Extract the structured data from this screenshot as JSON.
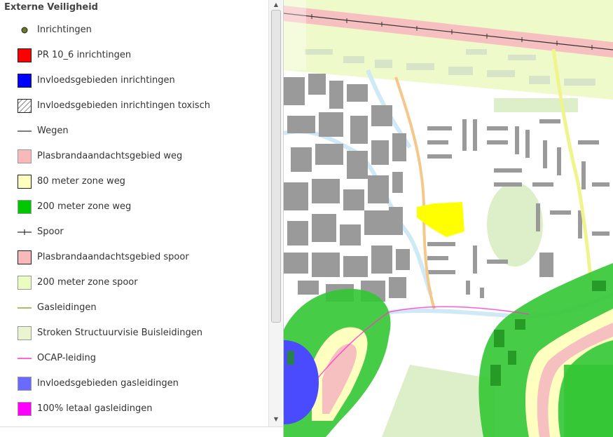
{
  "legend": {
    "title": "Externe Veiligheid",
    "items": [
      {
        "label": "Inrichtingen",
        "symbol": "dot",
        "color": "#6b7a1e"
      },
      {
        "label": "PR 10_6 inrichtingen",
        "symbol": "box",
        "color": "#ff0000"
      },
      {
        "label": "Invloedsgebieden inrichtingen",
        "symbol": "box",
        "color": "#0000ff"
      },
      {
        "label": "Invloedsgebieden inrichtingen toxisch",
        "symbol": "hatch",
        "color": "#ffffff"
      },
      {
        "label": "Wegen",
        "symbol": "line",
        "color": "#555555"
      },
      {
        "label": "Plasbrandaandachtsgebied weg",
        "symbol": "box-soft",
        "color": "#f7b9b9"
      },
      {
        "label": "80 meter zone weg",
        "symbol": "box",
        "color": "#ffffc0"
      },
      {
        "label": "200 meter zone weg",
        "symbol": "box-soft",
        "color": "#00c800"
      },
      {
        "label": "Spoor",
        "symbol": "rail",
        "color": "#333333"
      },
      {
        "label": "Plasbrandaandachtsgebied spoor",
        "symbol": "box",
        "color": "#f7b9b9"
      },
      {
        "label": "200 meter zone spoor",
        "symbol": "box-soft",
        "color": "#eafcc0"
      },
      {
        "label": "Gasleidingen",
        "symbol": "line",
        "color": "#8aaa3a"
      },
      {
        "label": "Stroken Structuurvisie Buisleidingen",
        "symbol": "box-soft",
        "color": "#eaf5d0"
      },
      {
        "label": "OCAP-leiding",
        "symbol": "line",
        "color": "#ff33cc"
      },
      {
        "label": "Invloedsgebieden gasleidingen",
        "symbol": "box-soft",
        "color": "#6a6aff"
      },
      {
        "label": "100% letaal gasleidingen",
        "symbol": "box-soft",
        "color": "#ff00ff"
      }
    ]
  },
  "map": {
    "colors": {
      "building": "#9a9a9a",
      "water": "#cfe9f6",
      "rail_zone": "#eefac8",
      "road_zone": "#f7c0c0",
      "green_zone": "#33c633",
      "yellow_site": "#ffff00",
      "influence_blue": "#4a4aff",
      "road_orange": "#f5c78a",
      "road_yellow": "#eff58c"
    }
  }
}
